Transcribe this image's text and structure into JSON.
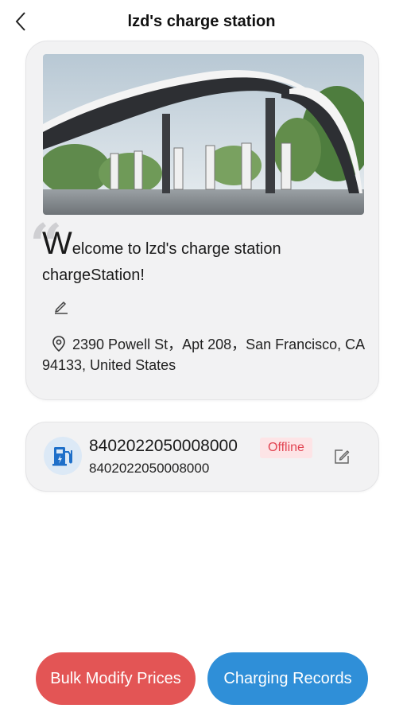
{
  "header": {
    "title": "lzd's charge station",
    "back_icon": "chevron-left-icon"
  },
  "station": {
    "welcome_first_letter": "W",
    "welcome_rest": "elcome to lzd's charge station chargeStation!",
    "address": "2390 Powell St，Apt 208，San Francisco, CA 94133, United States",
    "edit_icon": "pencil-icon",
    "location_icon": "map-pin-icon"
  },
  "device": {
    "name": "8402022050008000",
    "id": "8402022050008000",
    "status": "Offline",
    "status_color": "#e24452",
    "icon": "charging-pile-icon",
    "edit_icon": "edit-square-icon"
  },
  "actions": {
    "bulk_modify_label": "Bulk Modify Prices",
    "bulk_modify_color": "#e35555",
    "records_label": "Charging Records",
    "records_color": "#2f8fd8"
  }
}
